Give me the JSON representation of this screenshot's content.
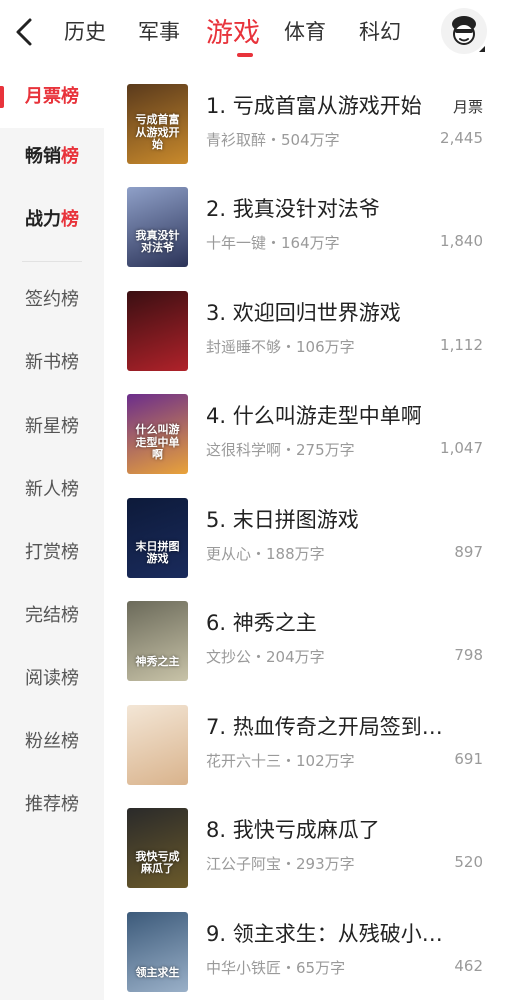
{
  "header": {
    "tabs": [
      {
        "label": "历史"
      },
      {
        "label": "军事"
      },
      {
        "label": "游戏"
      },
      {
        "label": "体育"
      },
      {
        "label": "科幻"
      }
    ],
    "active_tab": "游戏"
  },
  "sidebar": {
    "items": [
      {
        "label": "月票榜"
      },
      {
        "label_main": "畅销",
        "label_hl": "榜"
      },
      {
        "label_main": "战力",
        "label_hl": "榜"
      },
      {
        "label": "签约榜"
      },
      {
        "label": "新书榜"
      },
      {
        "label": "新星榜"
      },
      {
        "label": "新人榜"
      },
      {
        "label": "打赏榜"
      },
      {
        "label": "完结榜"
      },
      {
        "label": "阅读榜"
      },
      {
        "label": "粉丝榜"
      },
      {
        "label": "推荐榜"
      }
    ],
    "active": "月票榜"
  },
  "list": {
    "unit_label": "月票",
    "books": [
      {
        "title": "1. 亏成首富从游戏开始",
        "meta": "青衫取醉・504万字",
        "count": "2,445",
        "cover_text": "亏成首富从游戏开始",
        "cover_colors": [
          "#5a3a1c",
          "#c98a2c"
        ]
      },
      {
        "title": "2. 我真没针对法爷",
        "meta": "十年一键・164万字",
        "count": "1,840",
        "cover_text": "我真没针对法爷",
        "cover_colors": [
          "#8fa0c8",
          "#2b3358"
        ]
      },
      {
        "title": "3. 欢迎回归世界游戏",
        "meta": "封遥睡不够・106万字",
        "count": "1,112",
        "cover_text": "",
        "cover_colors": [
          "#3a0f12",
          "#b0222a"
        ]
      },
      {
        "title": "4. 什么叫游走型中单啊",
        "meta": "这很科学啊・275万字",
        "count": "1,047",
        "cover_text": "什么叫游走型中单啊",
        "cover_colors": [
          "#6b2d8c",
          "#e9a33a"
        ]
      },
      {
        "title": "5. 末日拼图游戏",
        "meta": "更从心・188万字",
        "count": "897",
        "cover_text": "末日拼图游戏",
        "cover_colors": [
          "#0d1a3a",
          "#1a2b5c"
        ]
      },
      {
        "title": "6. 神秀之主",
        "meta": "文抄公・204万字",
        "count": "798",
        "cover_text": "神秀之主",
        "cover_colors": [
          "#6b6a5a",
          "#c8c3a8"
        ]
      },
      {
        "title": "7. 热血传奇之开局签到…",
        "meta": "花开六十三・102万字",
        "count": "691",
        "cover_text": "",
        "cover_colors": [
          "#f3e6d6",
          "#d9b38c"
        ]
      },
      {
        "title": "8. 我快亏成麻瓜了",
        "meta": "江公子阿宝・293万字",
        "count": "520",
        "cover_text": "我快亏成麻瓜了",
        "cover_colors": [
          "#2a2a2a",
          "#6b5a2a"
        ]
      },
      {
        "title": "9. 领主求生：从残破小…",
        "meta": "中华小铁匠・65万字",
        "count": "462",
        "cover_text": "领主求生",
        "cover_colors": [
          "#3c5a7a",
          "#9ab0c8"
        ]
      }
    ]
  }
}
